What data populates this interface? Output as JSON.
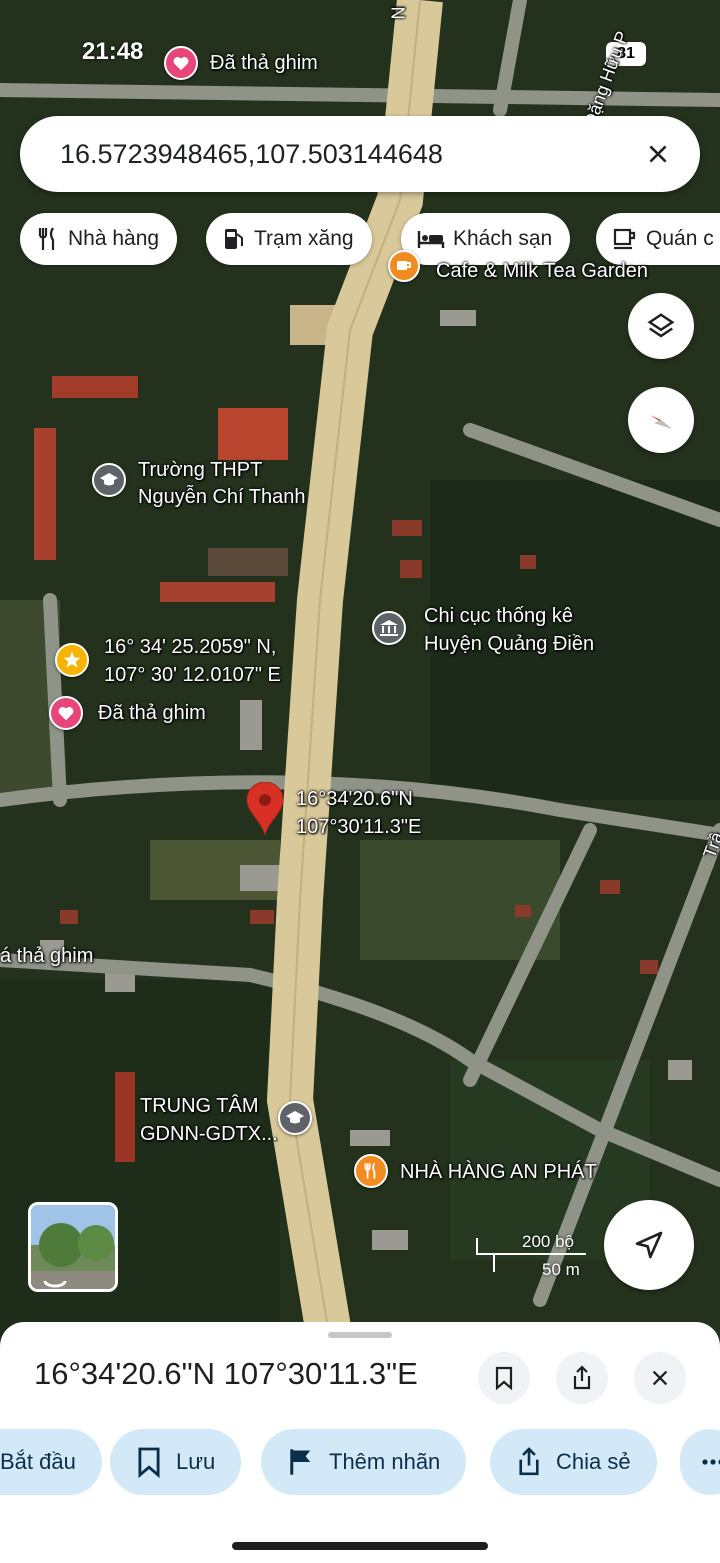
{
  "status_bar": {
    "time": "21:48",
    "battery": "81"
  },
  "search": {
    "query": "16.5723948465,107.503144648"
  },
  "chips": [
    {
      "label": "Nhà hàng",
      "icon": "restaurant-icon"
    },
    {
      "label": "Trạm xăng",
      "icon": "gas-station-icon"
    },
    {
      "label": "Khách sạn",
      "icon": "hotel-icon"
    },
    {
      "label": "Quán c",
      "icon": "cafe-icon"
    }
  ],
  "map": {
    "labels": {
      "saved_top": "Đã thả ghim",
      "street_top": "Đặng Hữu P",
      "road_n": "N",
      "cafe": "Cafe & Milk Tea Garden",
      "school_1": "Trường THPT",
      "school_2": "Nguyễn Chí Thanh",
      "stats_1": "Chi cục thống kê",
      "stats_2": "Huyện Quảng Điền",
      "star_1": "16° 34' 25.2059\" N,",
      "star_2": "107° 30' 12.0107\" E",
      "saved_mid": "Đã thả ghim",
      "pin_1": "16°34'20.6\"N",
      "pin_2": "107°30'11.3\"E",
      "saved_left": "á thả ghim",
      "center_1": "TRUNG TÂM",
      "center_2": "GDNN-GDTX...",
      "restaurant": "NHÀ HÀNG AN PHÁT",
      "street_right": "Trầ"
    },
    "scale": {
      "top": "200 bộ",
      "bottom": "50 m"
    }
  },
  "sheet": {
    "title": "16°34'20.6\"N 107°30'11.3\"E",
    "actions": [
      {
        "label": "Bắt đầu"
      },
      {
        "label": "Lưu"
      },
      {
        "label": "Thêm nhãn"
      },
      {
        "label": "Chia sẻ"
      }
    ]
  },
  "colors": {
    "accent_blue": "#1a73e8",
    "pin_red": "#d93025",
    "poi_orange": "#f28b20",
    "poi_gray": "#5f6368",
    "saved_pink": "#e8457a",
    "star_yellow": "#f6b400",
    "chip_blue": "#d3e9f7"
  }
}
